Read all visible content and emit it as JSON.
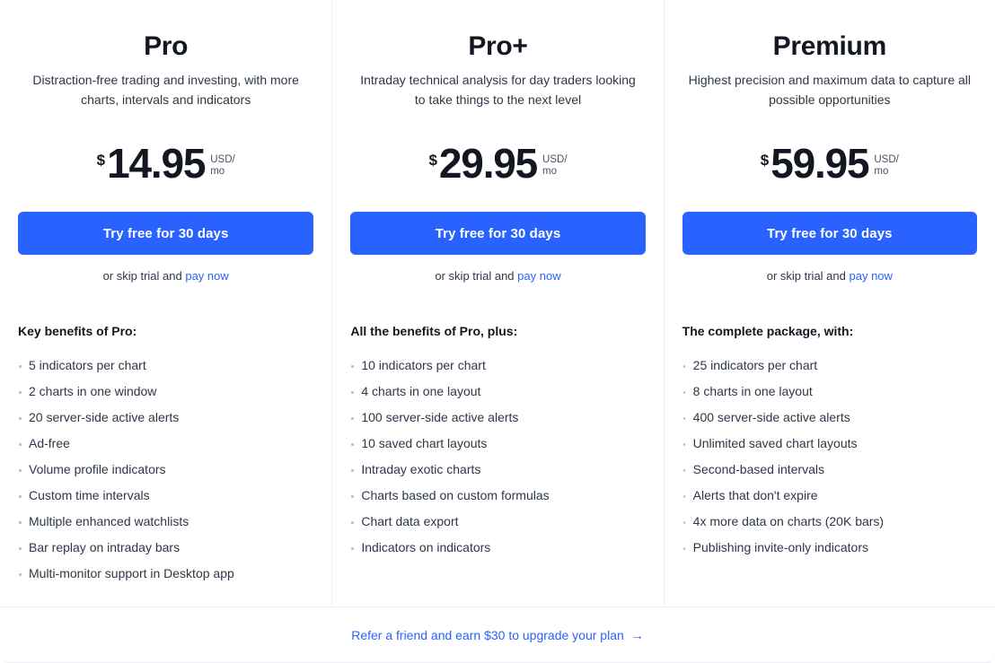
{
  "plans": [
    {
      "title": "Pro",
      "description": "Distraction-free trading and investing, with more charts, intervals and indicators",
      "currency": "$",
      "amount": "14.95",
      "unit": "USD/ mo",
      "cta_label": "Try free for 30 days",
      "skip_trial_text": "or skip trial and",
      "pay_now_label": "pay now",
      "benefits_title": "Key benefits of Pro:",
      "benefits": [
        "5 indicators per chart",
        "2 charts in one window",
        "20 server-side active alerts",
        "Ad-free",
        "Volume profile indicators",
        "Custom time intervals",
        "Multiple enhanced watchlists",
        "Bar replay on intraday bars",
        "Multi-monitor support in Desktop app"
      ]
    },
    {
      "title": "Pro+",
      "description": "Intraday technical analysis for day traders looking to take things to the next level",
      "currency": "$",
      "amount": "29.95",
      "unit": "USD/ mo",
      "cta_label": "Try free for 30 days",
      "skip_trial_text": "or skip trial and",
      "pay_now_label": "pay now",
      "benefits_title": "All the benefits of Pro, plus:",
      "benefits": [
        "10 indicators per chart",
        "4 charts in one layout",
        "100 server-side active alerts",
        "10 saved chart layouts",
        "Intraday exotic charts",
        "Charts based on custom formulas",
        "Chart data export",
        "Indicators on indicators"
      ]
    },
    {
      "title": "Premium",
      "description": "Highest precision and maximum data to capture all possible opportunities",
      "currency": "$",
      "amount": "59.95",
      "unit": "USD/ mo",
      "cta_label": "Try free for 30 days",
      "skip_trial_text": "or skip trial and",
      "pay_now_label": "pay now",
      "benefits_title": "The complete package, with:",
      "benefits": [
        "25 indicators per chart",
        "8 charts in one layout",
        "400 server-side active alerts",
        "Unlimited saved chart layouts",
        "Second-based intervals",
        "Alerts that don't expire",
        "4x more data on charts (20K bars)",
        "Publishing invite-only indicators"
      ]
    }
  ],
  "footer": {
    "refer_label": "Refer a friend and earn $30 to upgrade your plan",
    "arrow_glyph": "→"
  },
  "colors": {
    "accent": "#2962ff",
    "heading": "#131722",
    "body_text": "#2d3748",
    "divider": "#eceef1",
    "bullet": "#b6bcc7"
  }
}
